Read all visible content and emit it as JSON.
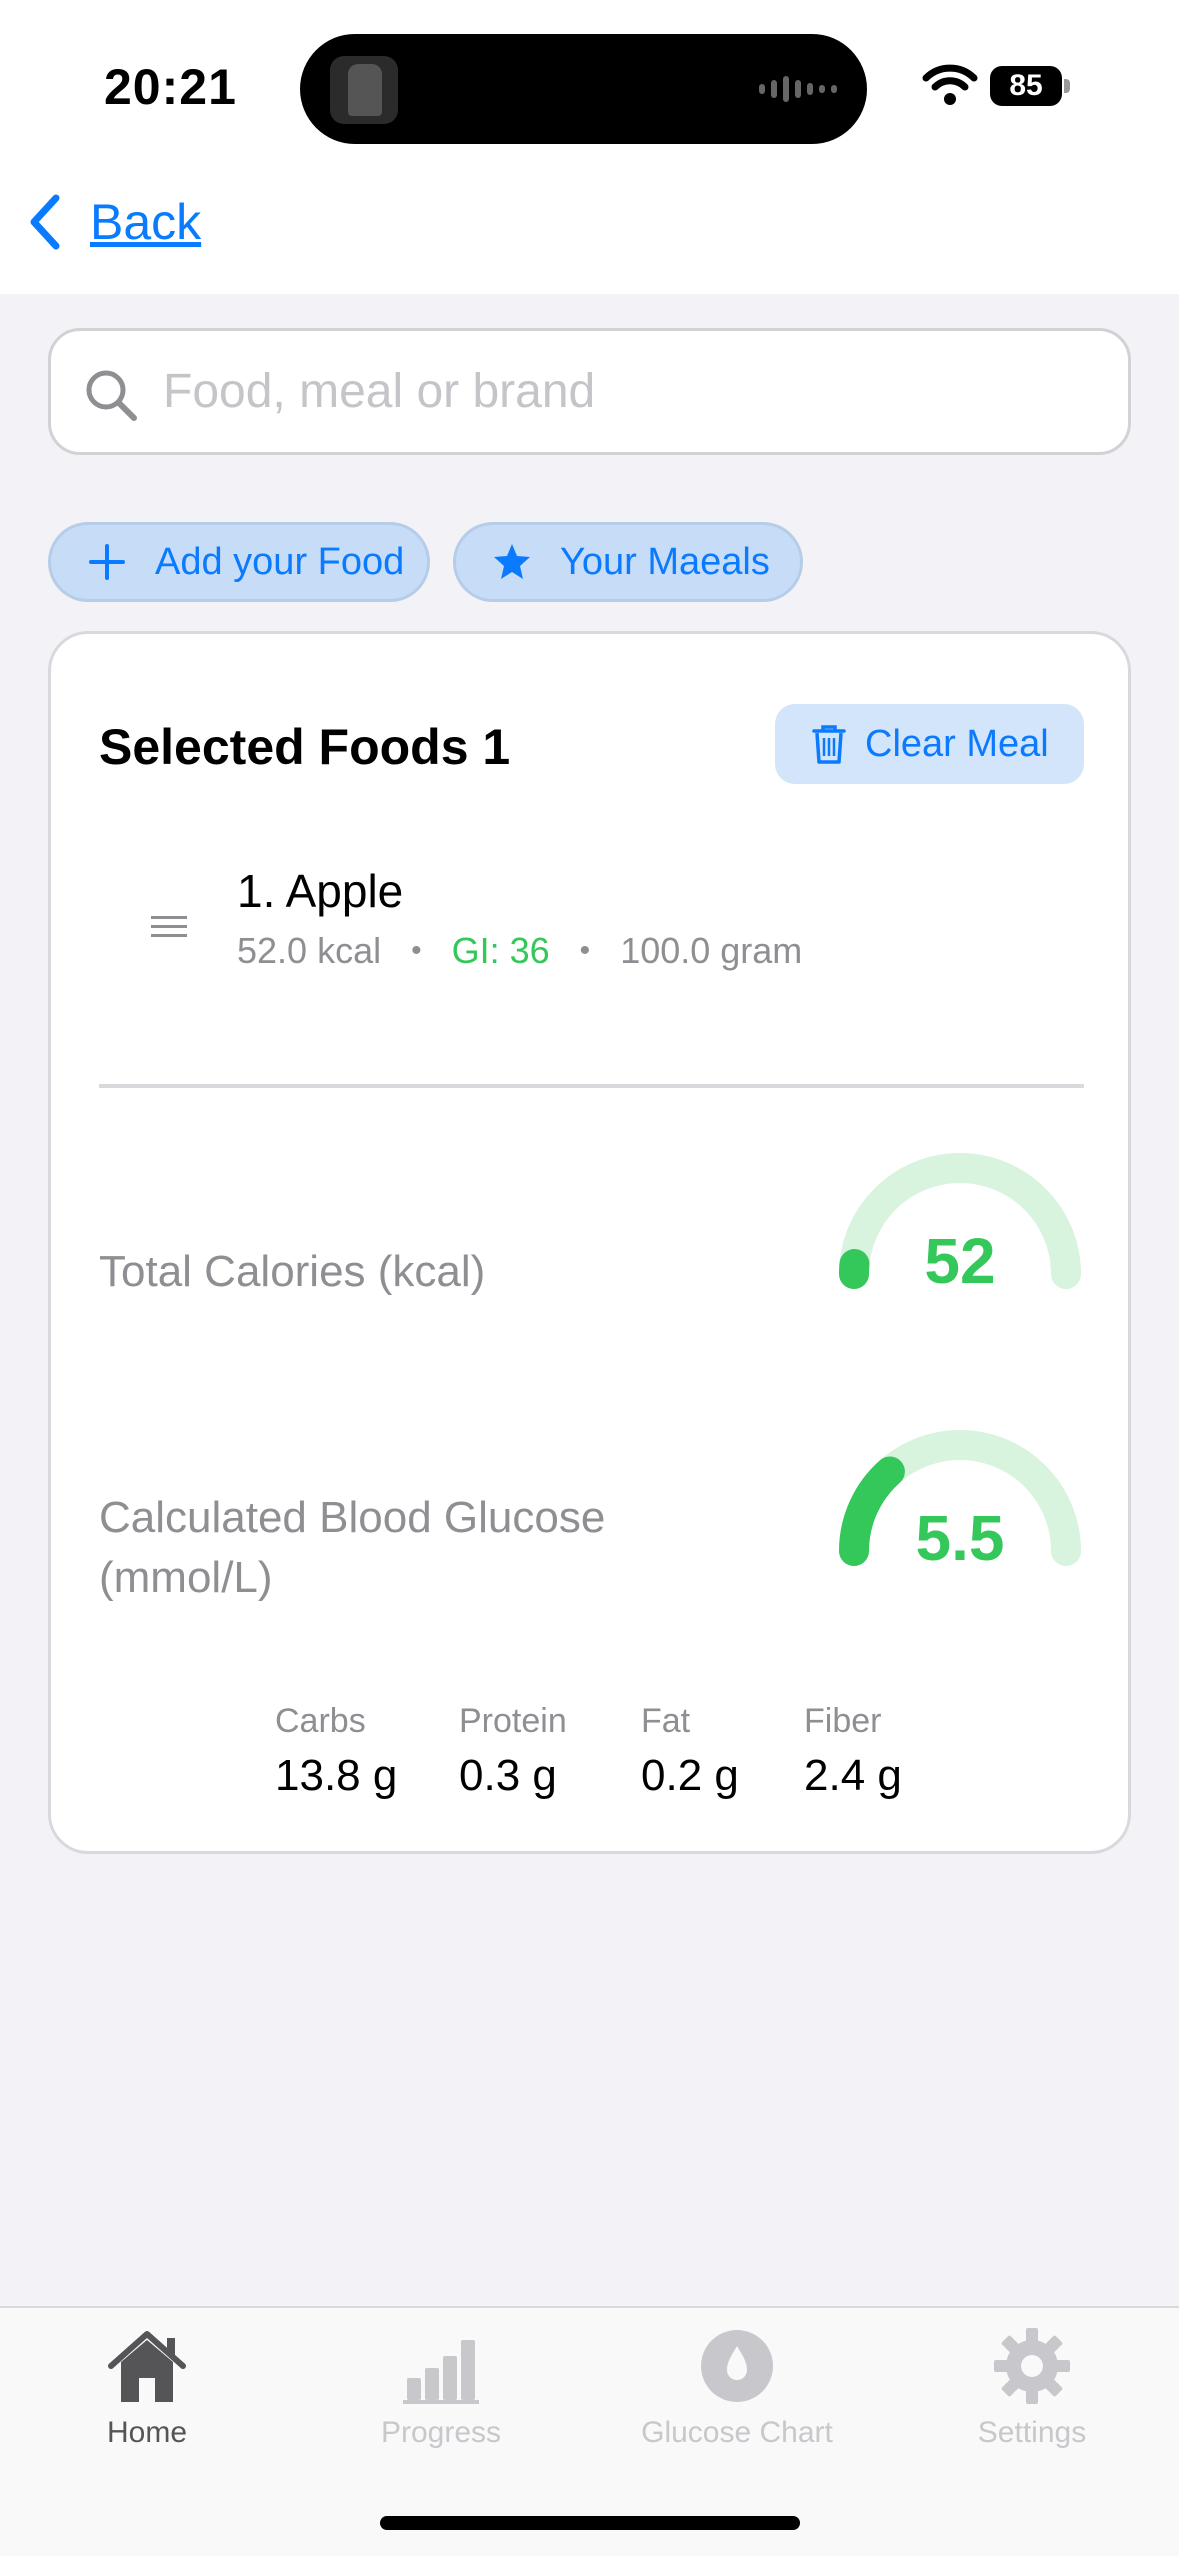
{
  "status_bar": {
    "time": "20:21",
    "battery_level": "85"
  },
  "nav": {
    "back_label": "Back"
  },
  "search": {
    "placeholder": "Food, meal or brand",
    "value": ""
  },
  "chips": {
    "add_food": "Add your Food",
    "your_meals": "Your Maeals"
  },
  "card": {
    "title": "Selected Foods 1",
    "clear_label": "Clear Meal",
    "foods": [
      {
        "name": "1. Apple",
        "kcal": "52.0 kcal",
        "gi": "GI: 36",
        "amount": "100.0 gram"
      }
    ],
    "separator": "•",
    "total_calories": {
      "label": "Total Calories (kcal)",
      "value": "52",
      "gauge_fraction": 0.03
    },
    "blood_glucose": {
      "label": "Calculated Blood Glucose (mmol/L)",
      "value": "5.5",
      "gauge_fraction": 0.27
    },
    "macros": [
      {
        "label": "Carbs",
        "value": "13.8 g"
      },
      {
        "label": "Protein",
        "value": "0.3 g"
      },
      {
        "label": "Fat",
        "value": "0.2 g"
      },
      {
        "label": "Fiber",
        "value": "2.4 g"
      }
    ]
  },
  "tabbar": {
    "items": [
      {
        "label": "Home",
        "icon": "house-icon",
        "active": true
      },
      {
        "label": "Progress",
        "icon": "bar-chart-icon",
        "active": false
      },
      {
        "label": "Glucose Chart",
        "icon": "drop-icon",
        "active": false
      },
      {
        "label": "Settings",
        "icon": "gear-icon",
        "active": false
      }
    ]
  },
  "colors": {
    "accent": "#0a7aff",
    "gauge_green": "#34c759",
    "gauge_track": "#d8f3de",
    "background": "#f2f2f7"
  }
}
